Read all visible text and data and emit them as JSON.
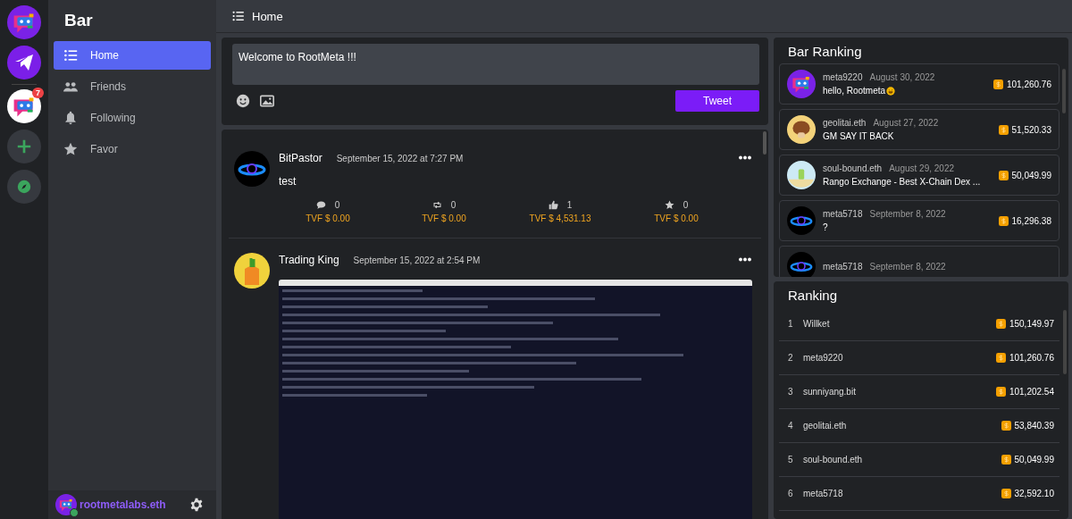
{
  "server_rail": [
    {
      "kind": "bot"
    },
    {
      "kind": "send"
    },
    {
      "kind": "bot-light",
      "badge": "7"
    },
    {
      "kind": "add"
    },
    {
      "kind": "explore"
    }
  ],
  "sidebar": {
    "title": "Bar",
    "items": [
      {
        "label": "Home",
        "selected": true
      },
      {
        "label": "Friends",
        "selected": false
      },
      {
        "label": "Following",
        "selected": false
      },
      {
        "label": "Favor",
        "selected": false
      }
    ],
    "user": {
      "name": "rootmetalabs.eth",
      "online": true
    }
  },
  "header": {
    "title": "Home"
  },
  "compose": {
    "value": "Welcome to RootMeta !!!",
    "button": "Tweet"
  },
  "posts": [
    {
      "author": "BitPastor",
      "time": "September 15, 2022 at 7:27 PM",
      "text": "test",
      "has_image": false,
      "stats": [
        {
          "count": "0",
          "value": "TVF $ 0.00"
        },
        {
          "count": "0",
          "value": "TVF $ 0.00"
        },
        {
          "count": "1",
          "value": "TVF $ 4,531.13"
        },
        {
          "count": "0",
          "value": "TVF $ 0.00"
        }
      ]
    },
    {
      "author": "Trading King",
      "time": "September 15, 2022 at 2:54 PM",
      "has_image": true
    }
  ],
  "bar_ranking": {
    "title": "Bar Ranking",
    "items": [
      {
        "name": "meta9220",
        "date": "August 30, 2022",
        "message": "hello, Rootmeta",
        "emoji": true,
        "amount": "101,260.76"
      },
      {
        "name": "geolitai.eth",
        "date": "August 27, 2022",
        "message": "GM SAY IT BACK",
        "emoji": false,
        "amount": "51,520.33"
      },
      {
        "name": "soul-bound.eth",
        "date": "August 29, 2022",
        "message": "Rango Exchange - Best X-Chain Dex ...",
        "emoji": false,
        "amount": "50,049.99"
      },
      {
        "name": "meta5718",
        "date": "September 8, 2022",
        "message": "?",
        "emoji": false,
        "amount": "16,296.38"
      },
      {
        "name": "meta5718",
        "date": "September 8, 2022"
      }
    ]
  },
  "ranking": {
    "title": "Ranking",
    "rows": [
      {
        "rank": "1",
        "name": "Willket",
        "amount": "150,149.97"
      },
      {
        "rank": "2",
        "name": "meta9220",
        "amount": "101,260.76"
      },
      {
        "rank": "3",
        "name": "sunniyang.bit",
        "amount": "101,202.54"
      },
      {
        "rank": "4",
        "name": "geolitai.eth",
        "amount": "53,840.39"
      },
      {
        "rank": "5",
        "name": "soul-bound.eth",
        "amount": "50,049.99"
      },
      {
        "rank": "6",
        "name": "meta5718",
        "amount": "32,592.10"
      }
    ]
  }
}
